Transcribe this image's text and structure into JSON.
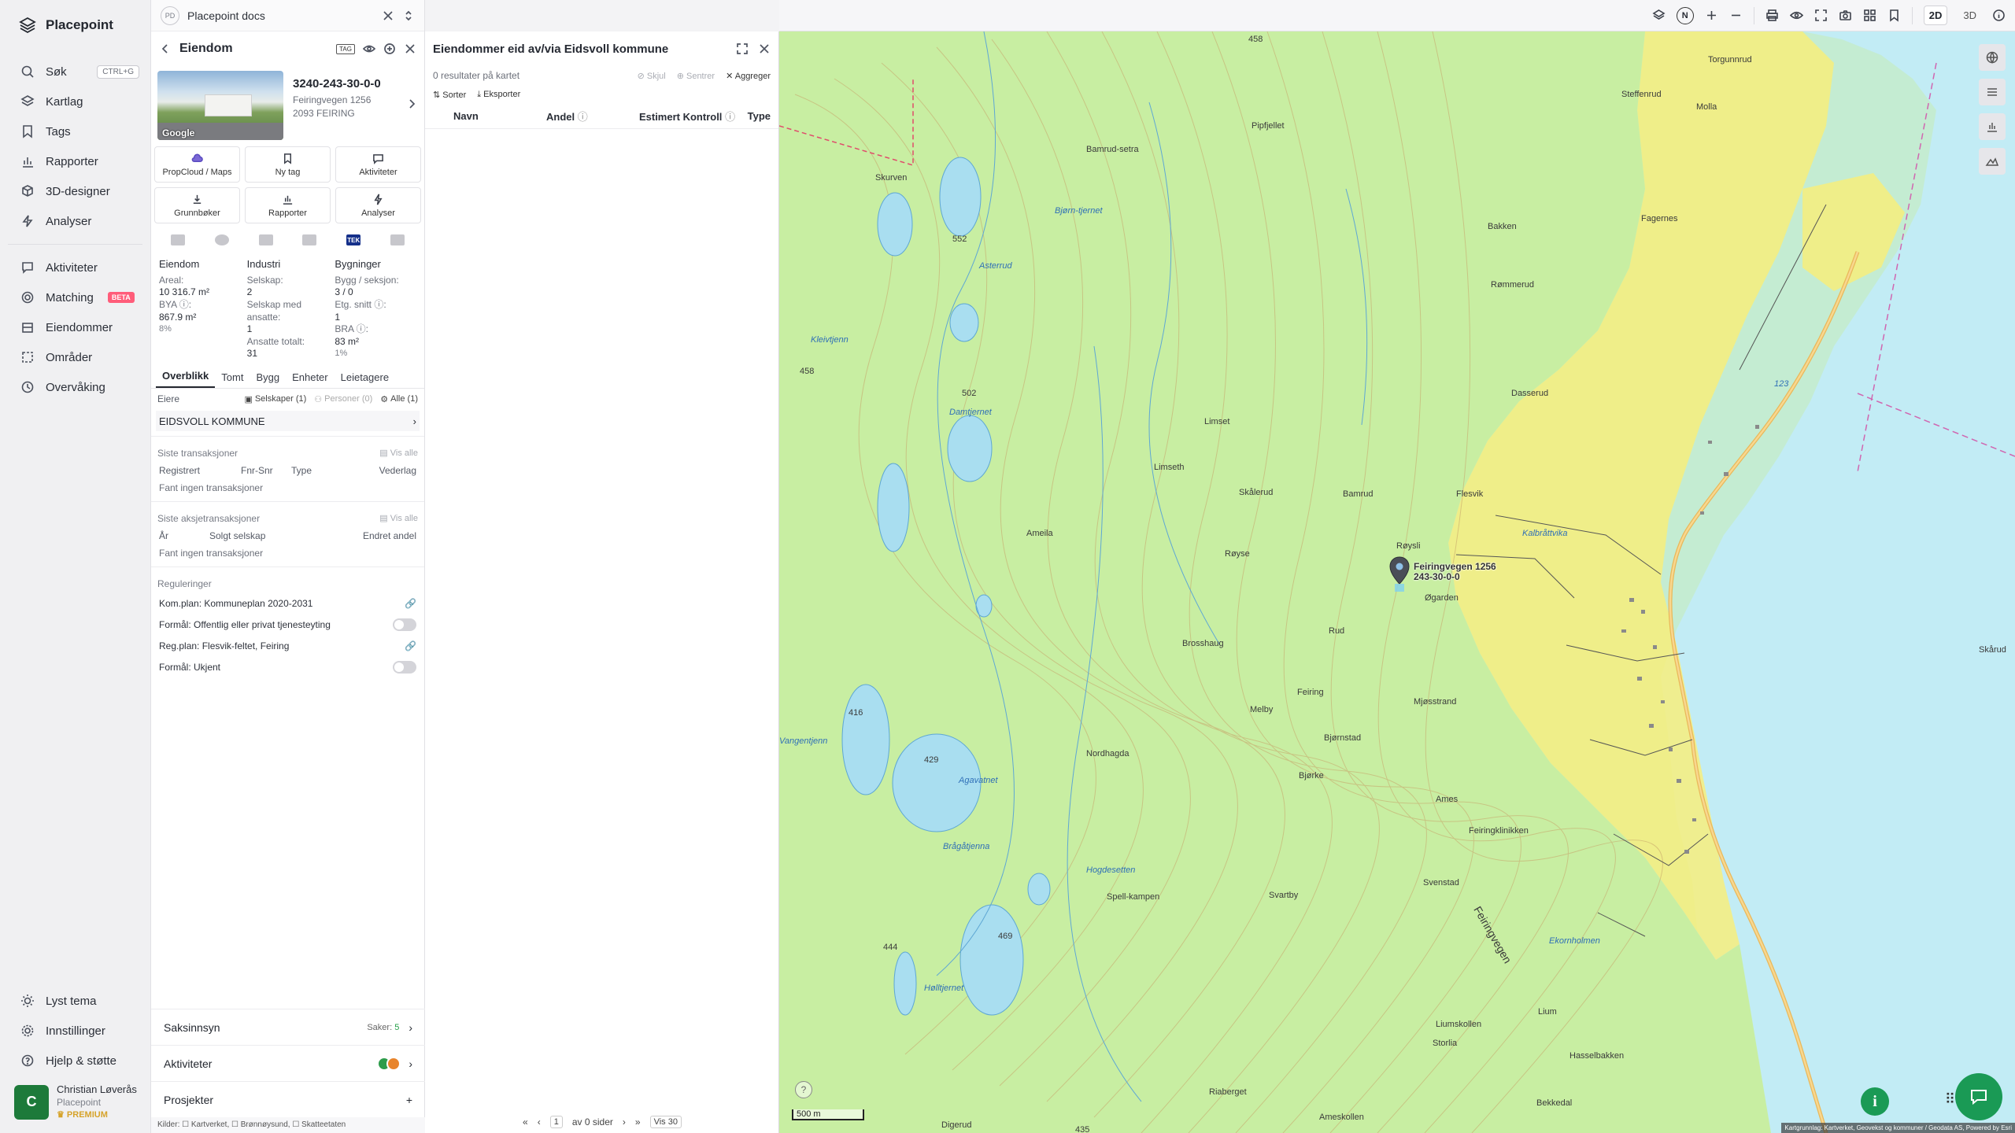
{
  "app": {
    "name": "Placepoint"
  },
  "nav": {
    "items": [
      {
        "label": "Søk",
        "shortcut": "CTRL+G"
      },
      {
        "label": "Kartlag"
      },
      {
        "label": "Tags"
      },
      {
        "label": "Rapporter"
      },
      {
        "label": "3D-designer"
      },
      {
        "label": "Analyser"
      }
    ],
    "items2": [
      {
        "label": "Aktiviteter"
      },
      {
        "label": "Matching",
        "badge": "BETA"
      },
      {
        "label": "Eiendommer"
      },
      {
        "label": "Områder"
      },
      {
        "label": "Overvåking"
      }
    ],
    "bottom": [
      {
        "label": "Lyst tema"
      },
      {
        "label": "Innstillinger"
      },
      {
        "label": "Hjelp & støtte"
      }
    ],
    "user": {
      "initial": "C",
      "name": "Christian Løverås",
      "org": "Placepoint",
      "plan": "PREMIUM"
    }
  },
  "docbar": {
    "badge": "PD",
    "title": "Placepoint docs"
  },
  "property": {
    "panel_title": "Eiendom",
    "tag_label": "TAG",
    "id": "3240-243-30-0-0",
    "street": "Feiringvegen 1256",
    "postal": "2093 FEIRING",
    "photo_credit": "Google",
    "actions": [
      {
        "label": "PropCloud / Maps"
      },
      {
        "label": "Ny tag"
      },
      {
        "label": "Aktiviteter"
      },
      {
        "label": "Grunnbøker"
      },
      {
        "label": "Rapporter"
      },
      {
        "label": "Analyser"
      }
    ],
    "sources": {
      "tek": "TEK"
    },
    "stats": {
      "col1": {
        "title": "Eiendom",
        "areal_label": "Areal:",
        "areal": "10 316.7 m²",
        "bya_label": "BYA ⓘ:",
        "bya": "867.9 m²",
        "bya_pct": "8%"
      },
      "col2": {
        "title": "Industri",
        "selskap_label": "Selskap:",
        "selskap": "2",
        "ansatte_label": "Selskap med ansatte:",
        "ansatte": "1",
        "totalt_label": "Ansatte totalt:",
        "totalt": "31"
      },
      "col3": {
        "title": "Bygninger",
        "bygg_label": "Bygg / seksjon:",
        "bygg": "3 / 0",
        "etg_label": "Etg. snitt ⓘ:",
        "etg": "1",
        "bra_label": "BRA ⓘ:",
        "bra": "83 m²",
        "bra_pct": "1%"
      }
    },
    "tabs": [
      "Overblikk",
      "Tomt",
      "Bygg",
      "Enheter",
      "Leietagere"
    ],
    "owners": {
      "label": "Eiere",
      "chip_companies": "Selskaper (1)",
      "chip_persons": "Personer (0)",
      "chip_all": "Alle (1)",
      "owner_name": "EIDSVOLL KOMMUNE"
    },
    "transactions": {
      "title": "Siste transaksjoner",
      "view_all": "Vis alle",
      "cols": [
        "Registrert",
        "Fnr-Snr",
        "Type",
        "Vederlag"
      ],
      "empty": "Fant ingen transaksjoner"
    },
    "share_transactions": {
      "title": "Siste aksjetransaksjoner",
      "view_all": "Vis alle",
      "cols": [
        "År",
        "Solgt selskap",
        "Endret andel"
      ],
      "empty": "Fant ingen transaksjoner"
    },
    "regulations": {
      "title": "Reguleringer",
      "rows": [
        {
          "label": "Kom.plan: Kommuneplan 2020-2031",
          "kind": "link"
        },
        {
          "label": "Formål: Offentlig eller privat tjenesteyting",
          "kind": "toggle"
        },
        {
          "label": "Reg.plan: Flesvik-feltet, Feiring",
          "kind": "link"
        },
        {
          "label": "Formål: Ukjent",
          "kind": "toggle"
        }
      ]
    },
    "bottom_sections": {
      "saksinnsyn": "Saksinnsyn",
      "saker_label": "Saker:",
      "saker_count": "5",
      "aktiviteter": "Aktiviteter",
      "prosjekter": "Prosjekter"
    },
    "footer": "Kilder: ☐ Kartverket, ☐ Brønnøysund, ☐ Skatteetaten"
  },
  "list": {
    "title": "Eiendommer eid av/via Eidsvoll kommune",
    "results": "0 resultater på kartet",
    "hide": "Skjul",
    "center": "Sentrer",
    "aggregate": "Aggreger",
    "sort": "Sorter",
    "export": "Eksporter",
    "cols": [
      "Navn",
      "Andel",
      "Estimert Kontroll",
      "Type"
    ],
    "pager": {
      "page": "1",
      "of": "av 0 sider",
      "show": "Vis 30"
    }
  },
  "toolbar": {
    "compass": "N",
    "mode2d": "2D",
    "mode3d": "3D"
  },
  "map": {
    "pin_label_1": "Feiringvegen 1256",
    "pin_label_2": "243-30-0-0",
    "scale": "500 m",
    "attribution": "Kartgrunnlag: Kartverket, Geovekst og kommuner / Geodata AS, Powered by Esri",
    "places": [
      "Torgunnrud",
      "Molla",
      "Steffenrud",
      "Pipfjellet",
      "Bamrud-setra",
      "Skurven",
      "Bjørn-tjernet",
      "Bakken",
      "Fagernes",
      "Asterrud",
      "Rømmerud",
      "Kleivtjenn",
      "Damtjernet",
      "Dasserud",
      "Limset",
      "Limseth",
      "Skålerud",
      "Bamrud",
      "Flesvik",
      "Kalbråttvika",
      "Ameila",
      "Røyse",
      "Røysli",
      "Øgarden",
      "Rud",
      "Brosshaug",
      "Feiring",
      "Melby",
      "Mjøsstrand",
      "Vangentjenn",
      "Nordhagda",
      "Bjørnstad",
      "Bjørke",
      "Ames",
      "Agavatnet",
      "Feiringklinikken",
      "Brågåtjenna",
      "Hogdesetten",
      "Spell-kampen",
      "Svenstad",
      "Svartby",
      "Hølltjernet",
      "Ekornholmen",
      "Lium",
      "Liumskollen",
      "Hasselbakken",
      "Riaberget",
      "Bekkedal",
      "Ameskollen",
      "Skårud",
      "Digerud",
      "Storlia",
      "Feiringvegen"
    ],
    "elevations": [
      "458",
      "552",
      "458",
      "502",
      "416",
      "429",
      "469",
      "444",
      "435",
      "123"
    ]
  }
}
